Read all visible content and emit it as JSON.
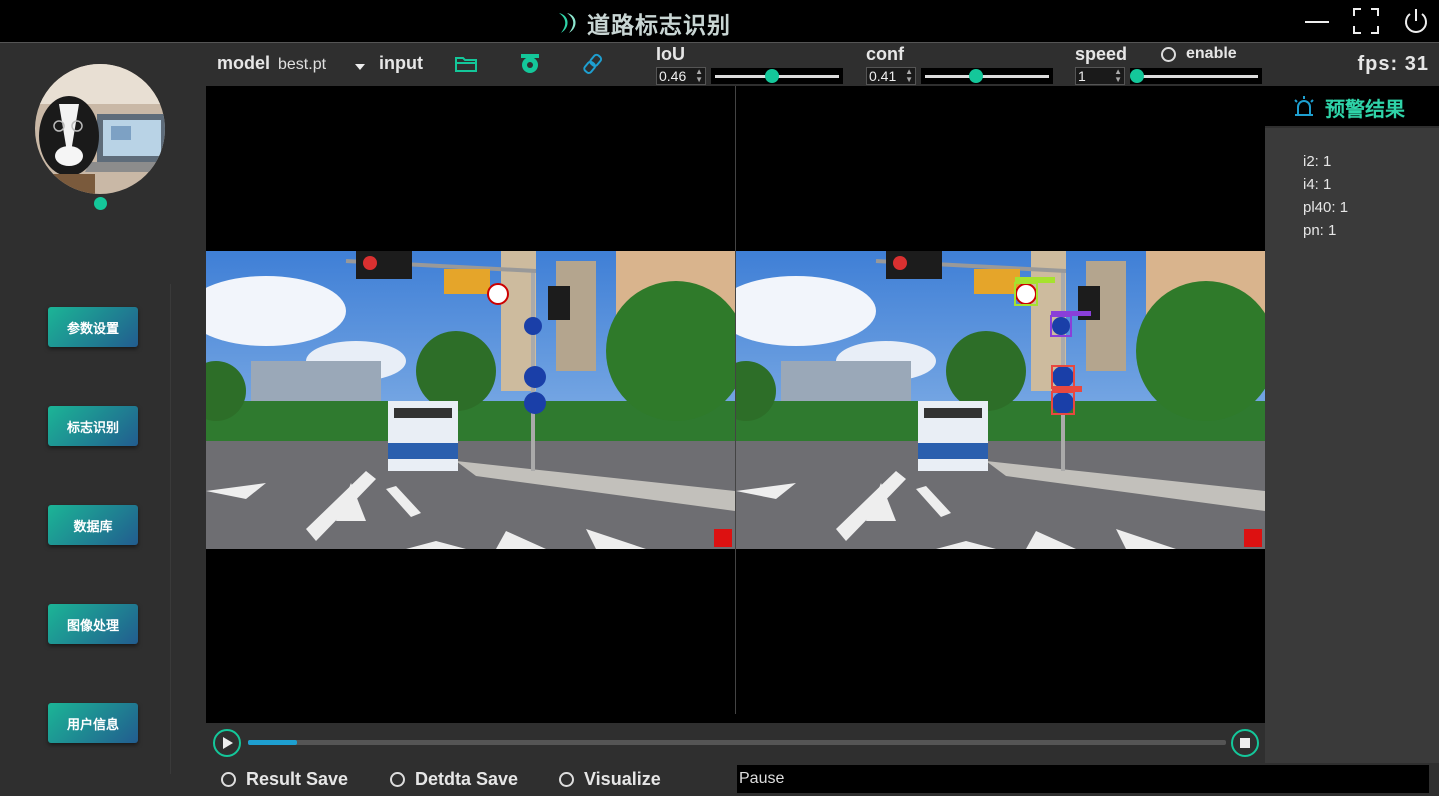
{
  "app": {
    "title": "道路标志识别"
  },
  "sidebar": {
    "items": [
      {
        "label": "参数设置"
      },
      {
        "label": "标志识别"
      },
      {
        "label": "数据库"
      },
      {
        "label": "图像处理"
      },
      {
        "label": "用户信息"
      }
    ]
  },
  "toolbar": {
    "model_label": "model",
    "model_value": "best.pt",
    "input_label": "input",
    "iou": {
      "label": "IoU",
      "value": "0.46",
      "level": 0.46
    },
    "conf": {
      "label": "conf",
      "value": "0.41",
      "level": 0.41
    },
    "speed": {
      "label": "speed",
      "value": "1",
      "level": 0.0
    },
    "enable_label": "enable",
    "fps_label": "fps:",
    "fps_value": "31"
  },
  "icons": [
    "folder-open-icon",
    "camera-icon",
    "link-icon",
    "play-icon",
    "stop-icon",
    "alarm-icon",
    "minimize-icon",
    "fullscreen-icon",
    "power-icon",
    "logo-icon"
  ],
  "results": {
    "header": "预警结果",
    "items": [
      "i2:  1",
      "i4:  1",
      "pl40:  1",
      "pn:  1"
    ]
  },
  "playback": {
    "progress": 0.05
  },
  "bottom": {
    "result_save": "Result Save",
    "detdata_save": "Detdta Save",
    "visualize": "Visualize",
    "status": "Pause"
  },
  "colors": {
    "accent": "#14c79a",
    "button_gradient_start": "#1bb596",
    "button_gradient_end": "#225c8f",
    "progress": "#1e9fd0"
  }
}
